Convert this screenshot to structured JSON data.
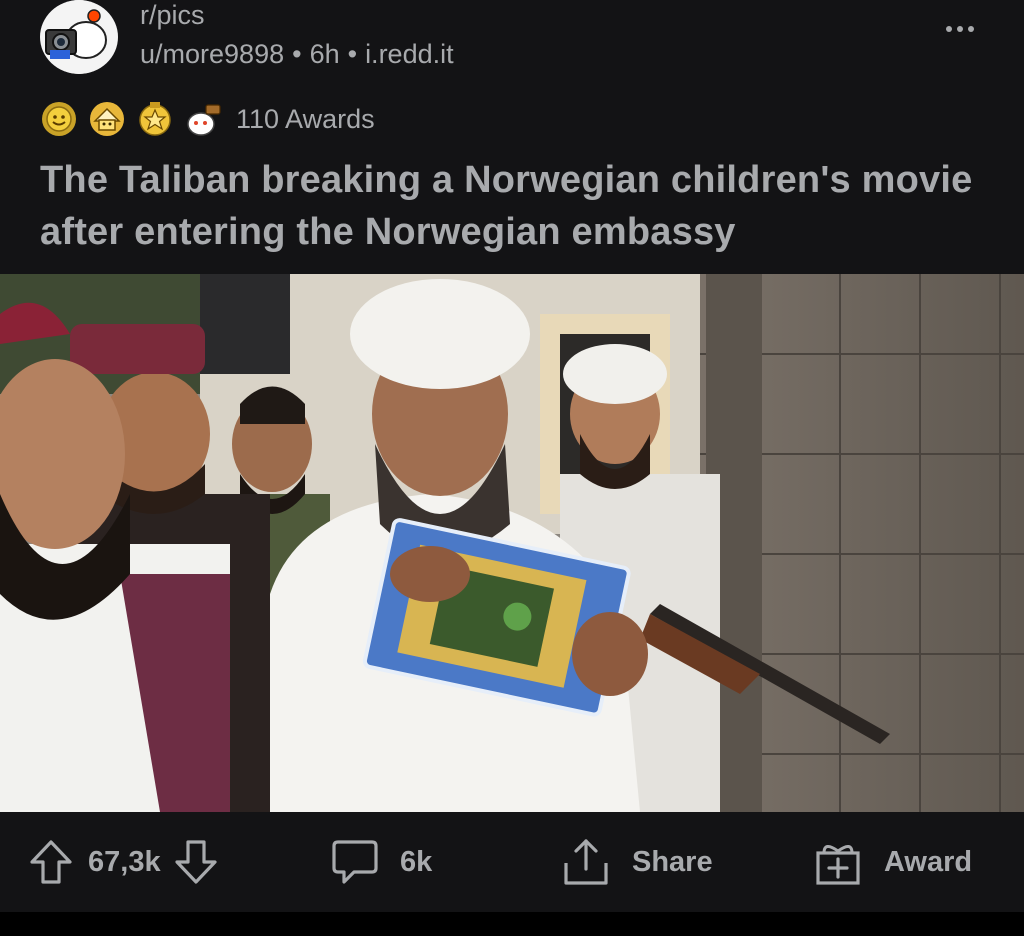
{
  "header": {
    "subreddit": "r/pics",
    "user": "u/more9898",
    "age": "6h",
    "domain": "i.redd.it",
    "more_icon": "more-horizontal-icon"
  },
  "awards": {
    "icons": [
      "gold-sun-award-icon",
      "wholesome-award-icon",
      "silver-star-award-icon",
      "snoo-award-icon"
    ],
    "count_label": "110 Awards"
  },
  "post": {
    "title": "The Taliban breaking a Norwegian children's movie after entering the Norwegian embassy",
    "image_alt": "photo of bearded men in turbans, one breaking a DVD case, an armed man behind"
  },
  "actions": {
    "upvote_icon": "arrow-up-icon",
    "score": "67,3k",
    "downvote_icon": "arrow-down-icon",
    "comments_icon": "comment-bubble-icon",
    "comments": "6k",
    "share_icon": "share-icon",
    "share_label": "Share",
    "award_icon": "gift-icon",
    "award_label": "Award"
  },
  "colors": {
    "background": "#131315",
    "text_muted": "#a8aaad",
    "subreddit_icon_bg": "#f4f4f4"
  }
}
